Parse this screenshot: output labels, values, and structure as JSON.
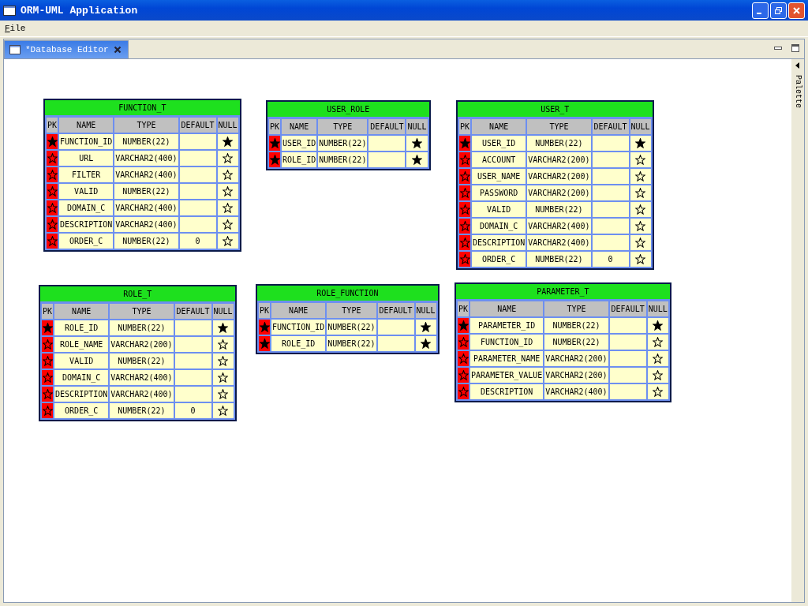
{
  "window": {
    "title": "ORM-UML Application"
  },
  "menu": [
    {
      "label": "File"
    }
  ],
  "tabs": [
    {
      "label": "*Database Editor",
      "selected": true
    }
  ],
  "palette": {
    "label": "Palette"
  },
  "tables": [
    {
      "name": "FUNCTION_T",
      "columns": [
        "PK",
        "NAME",
        "TYPE",
        "DEFAULT",
        "NULL"
      ],
      "rows": [
        {
          "primary_key": true,
          "name": "FUNCTION_ID",
          "type": "NUMBER(22)",
          "default": "",
          "not_null": true
        },
        {
          "primary_key": false,
          "name": "URL",
          "type": "VARCHAR2(400)",
          "default": "",
          "not_null": false
        },
        {
          "primary_key": false,
          "name": "FILTER",
          "type": "VARCHAR2(400)",
          "default": "",
          "not_null": false
        },
        {
          "primary_key": false,
          "name": "VALID",
          "type": "NUMBER(22)",
          "default": "",
          "not_null": false
        },
        {
          "primary_key": false,
          "name": "DOMAIN_C",
          "type": "VARCHAR2(400)",
          "default": "",
          "not_null": false
        },
        {
          "primary_key": false,
          "name": "DESCRIPTION",
          "type": "VARCHAR2(400)",
          "default": "",
          "not_null": false
        },
        {
          "primary_key": false,
          "name": "ORDER_C",
          "type": "NUMBER(22)",
          "default": "0",
          "not_null": false
        }
      ]
    },
    {
      "name": "USER_ROLE",
      "columns": [
        "PK",
        "NAME",
        "TYPE",
        "DEFAULT",
        "NULL"
      ],
      "rows": [
        {
          "primary_key": true,
          "name": "USER_ID",
          "type": "NUMBER(22)",
          "default": "",
          "not_null": true
        },
        {
          "primary_key": true,
          "name": "ROLE_ID",
          "type": "NUMBER(22)",
          "default": "",
          "not_null": true
        }
      ]
    },
    {
      "name": "USER_T",
      "columns": [
        "PK",
        "NAME",
        "TYPE",
        "DEFAULT",
        "NULL"
      ],
      "rows": [
        {
          "primary_key": true,
          "name": "USER_ID",
          "type": "NUMBER(22)",
          "default": "",
          "not_null": true
        },
        {
          "primary_key": false,
          "name": "ACCOUNT",
          "type": "VARCHAR2(200)",
          "default": "",
          "not_null": false
        },
        {
          "primary_key": false,
          "name": "USER_NAME",
          "type": "VARCHAR2(200)",
          "default": "",
          "not_null": false
        },
        {
          "primary_key": false,
          "name": "PASSWORD",
          "type": "VARCHAR2(200)",
          "default": "",
          "not_null": false
        },
        {
          "primary_key": false,
          "name": "VALID",
          "type": "NUMBER(22)",
          "default": "",
          "not_null": false
        },
        {
          "primary_key": false,
          "name": "DOMAIN_C",
          "type": "VARCHAR2(400)",
          "default": "",
          "not_null": false
        },
        {
          "primary_key": false,
          "name": "DESCRIPTION",
          "type": "VARCHAR2(400)",
          "default": "",
          "not_null": false
        },
        {
          "primary_key": false,
          "name": "ORDER_C",
          "type": "NUMBER(22)",
          "default": "0",
          "not_null": false
        }
      ]
    },
    {
      "name": "ROLE_T",
      "columns": [
        "PK",
        "NAME",
        "TYPE",
        "DEFAULT",
        "NULL"
      ],
      "rows": [
        {
          "primary_key": true,
          "name": "ROLE_ID",
          "type": "NUMBER(22)",
          "default": "",
          "not_null": true
        },
        {
          "primary_key": false,
          "name": "ROLE_NAME",
          "type": "VARCHAR2(200)",
          "default": "",
          "not_null": false
        },
        {
          "primary_key": false,
          "name": "VALID",
          "type": "NUMBER(22)",
          "default": "",
          "not_null": false
        },
        {
          "primary_key": false,
          "name": "DOMAIN_C",
          "type": "VARCHAR2(400)",
          "default": "",
          "not_null": false
        },
        {
          "primary_key": false,
          "name": "DESCRIPTION",
          "type": "VARCHAR2(400)",
          "default": "",
          "not_null": false
        },
        {
          "primary_key": false,
          "name": "ORDER_C",
          "type": "NUMBER(22)",
          "default": "0",
          "not_null": false
        }
      ]
    },
    {
      "name": "ROLE_FUNCTION",
      "columns": [
        "PK",
        "NAME",
        "TYPE",
        "DEFAULT",
        "NULL"
      ],
      "rows": [
        {
          "primary_key": true,
          "name": "FUNCTION_ID",
          "type": "NUMBER(22)",
          "default": "",
          "not_null": true
        },
        {
          "primary_key": true,
          "name": "ROLE_ID",
          "type": "NUMBER(22)",
          "default": "",
          "not_null": true
        }
      ]
    },
    {
      "name": "PARAMETER_T",
      "columns": [
        "PK",
        "NAME",
        "TYPE",
        "DEFAULT",
        "NULL"
      ],
      "rows": [
        {
          "primary_key": true,
          "name": "PARAMETER_ID",
          "type": "NUMBER(22)",
          "default": "",
          "not_null": true
        },
        {
          "primary_key": false,
          "name": "FUNCTION_ID",
          "type": "NUMBER(22)",
          "default": "",
          "not_null": false
        },
        {
          "primary_key": false,
          "name": "PARAMETER_NAME",
          "type": "VARCHAR2(200)",
          "default": "",
          "not_null": false
        },
        {
          "primary_key": false,
          "name": "PARAMETER_VALUE",
          "type": "VARCHAR2(200)",
          "default": "",
          "not_null": false
        },
        {
          "primary_key": false,
          "name": "DESCRIPTION",
          "type": "VARCHAR2(400)",
          "default": "",
          "not_null": false
        }
      ]
    }
  ]
}
